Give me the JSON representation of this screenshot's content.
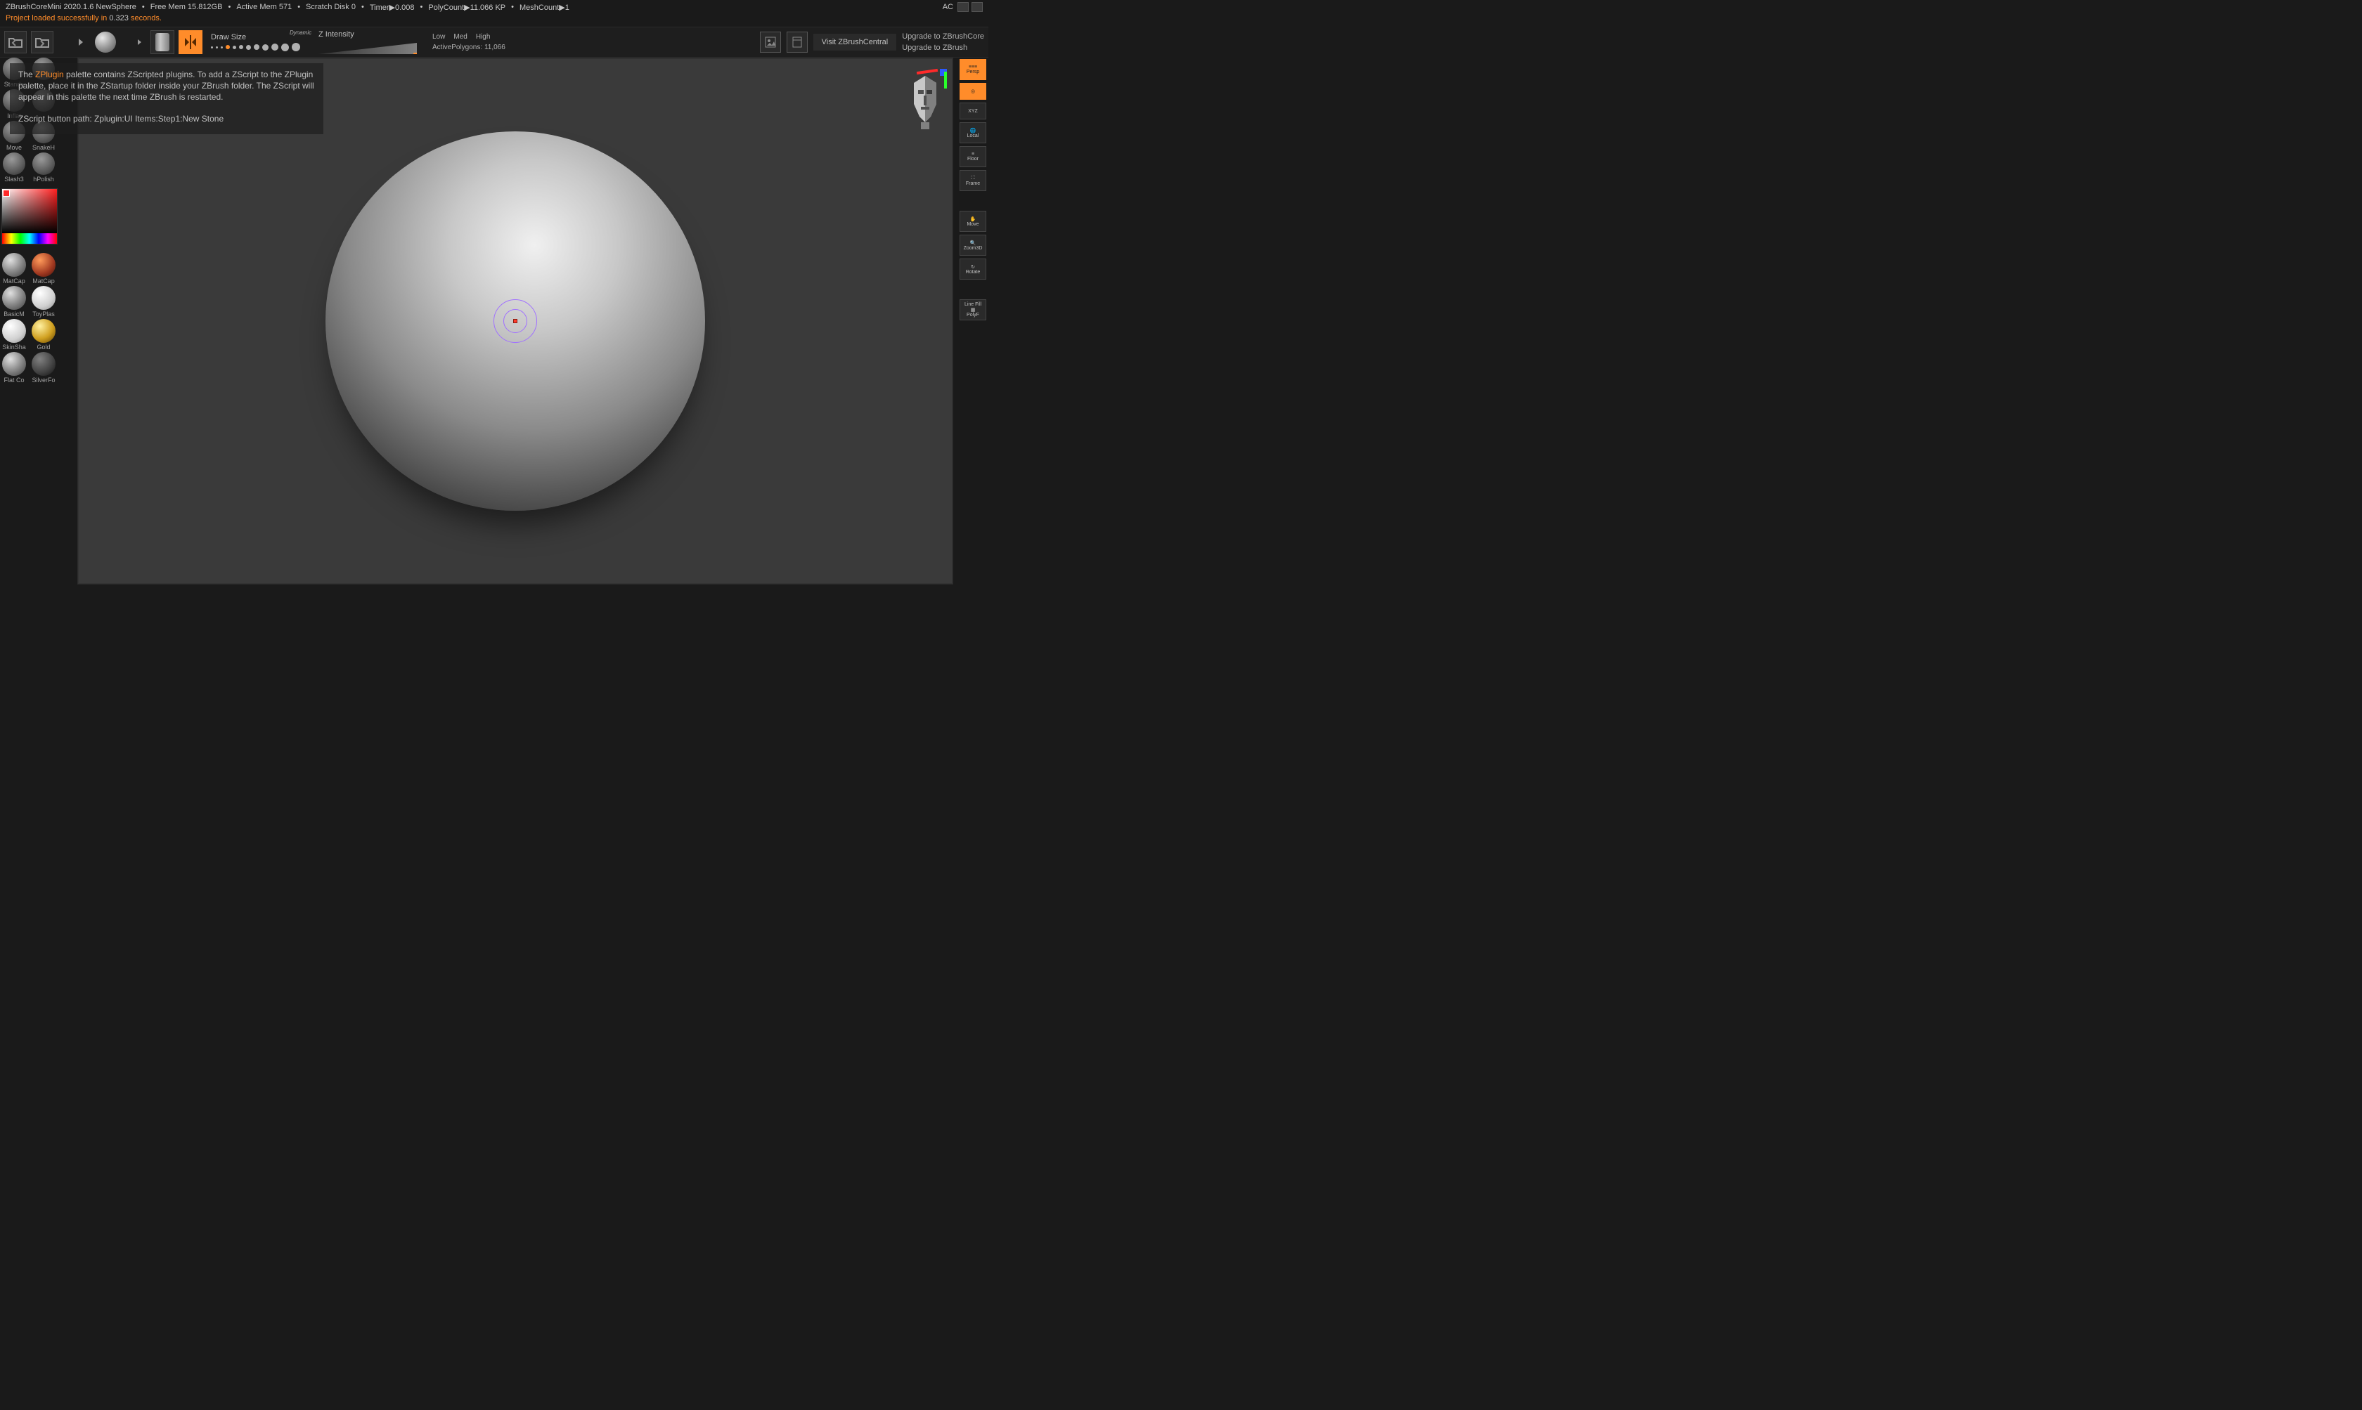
{
  "app": {
    "title": "ZBrushCoreMini 2020.1.6 NewSphere",
    "free_mem": "Free Mem 15.812GB",
    "active_mem": "Active Mem 571",
    "scratch": "Scratch Disk 0",
    "timer": "Timer▶0.008",
    "polycount": "PolyCount▶11.066 KP",
    "meshcount": "MeshCount▶1",
    "ac": "AC"
  },
  "status": {
    "prefix": "Project loaded successfully in ",
    "seconds": "0.323",
    "suffix": " seconds."
  },
  "toolbar": {
    "drawsize_label": "Draw Size",
    "dynamic_label": "Dynamic",
    "zintensity_label": "Z Intensity",
    "quality": {
      "low": "Low",
      "med": "Med",
      "high": "High"
    },
    "active_polygons_label": "ActivePolygons:",
    "active_polygons_value": "11,066",
    "visit_central": "Visit ZBrushCentral",
    "upgrade_core": "Upgrade to ZBrushCore",
    "upgrade_zbrush": "Upgrade to ZBrush"
  },
  "brushes": {
    "0": "Standa",
    "1": "",
    "2": "Inflat",
    "3": "",
    "4": "Move",
    "5": "SnakeH",
    "6": "Slash3",
    "7": "hPolish"
  },
  "materials": {
    "0": "MatCap",
    "1": "MatCap",
    "2": "BasicM",
    "3": "ToyPlas",
    "4": "SkinSha",
    "5": "Gold",
    "6": "Flat Co",
    "7": "SilverFo"
  },
  "right": {
    "persp": "Persp",
    "xyz": "XYZ",
    "local": "Local",
    "floor": "Floor",
    "frame": "Frame",
    "move": "Move",
    "zoom": "Zoom3D",
    "rotate": "Rotate",
    "linefill": "Line Fill",
    "polyf": "PolyF"
  },
  "tooltip": {
    "p1a": "The ",
    "kw": "ZPlugin",
    "p1b": " palette contains ZScripted plugins. To add a ZScript to the ZPlugin palette, place it in the ZStartup folder inside your ZBrush folder. The ZScript will appear in this palette the next time ZBrush is restarted.",
    "p2": "ZScript button path: Zplugin:UI Items:Step1:New Stone"
  }
}
